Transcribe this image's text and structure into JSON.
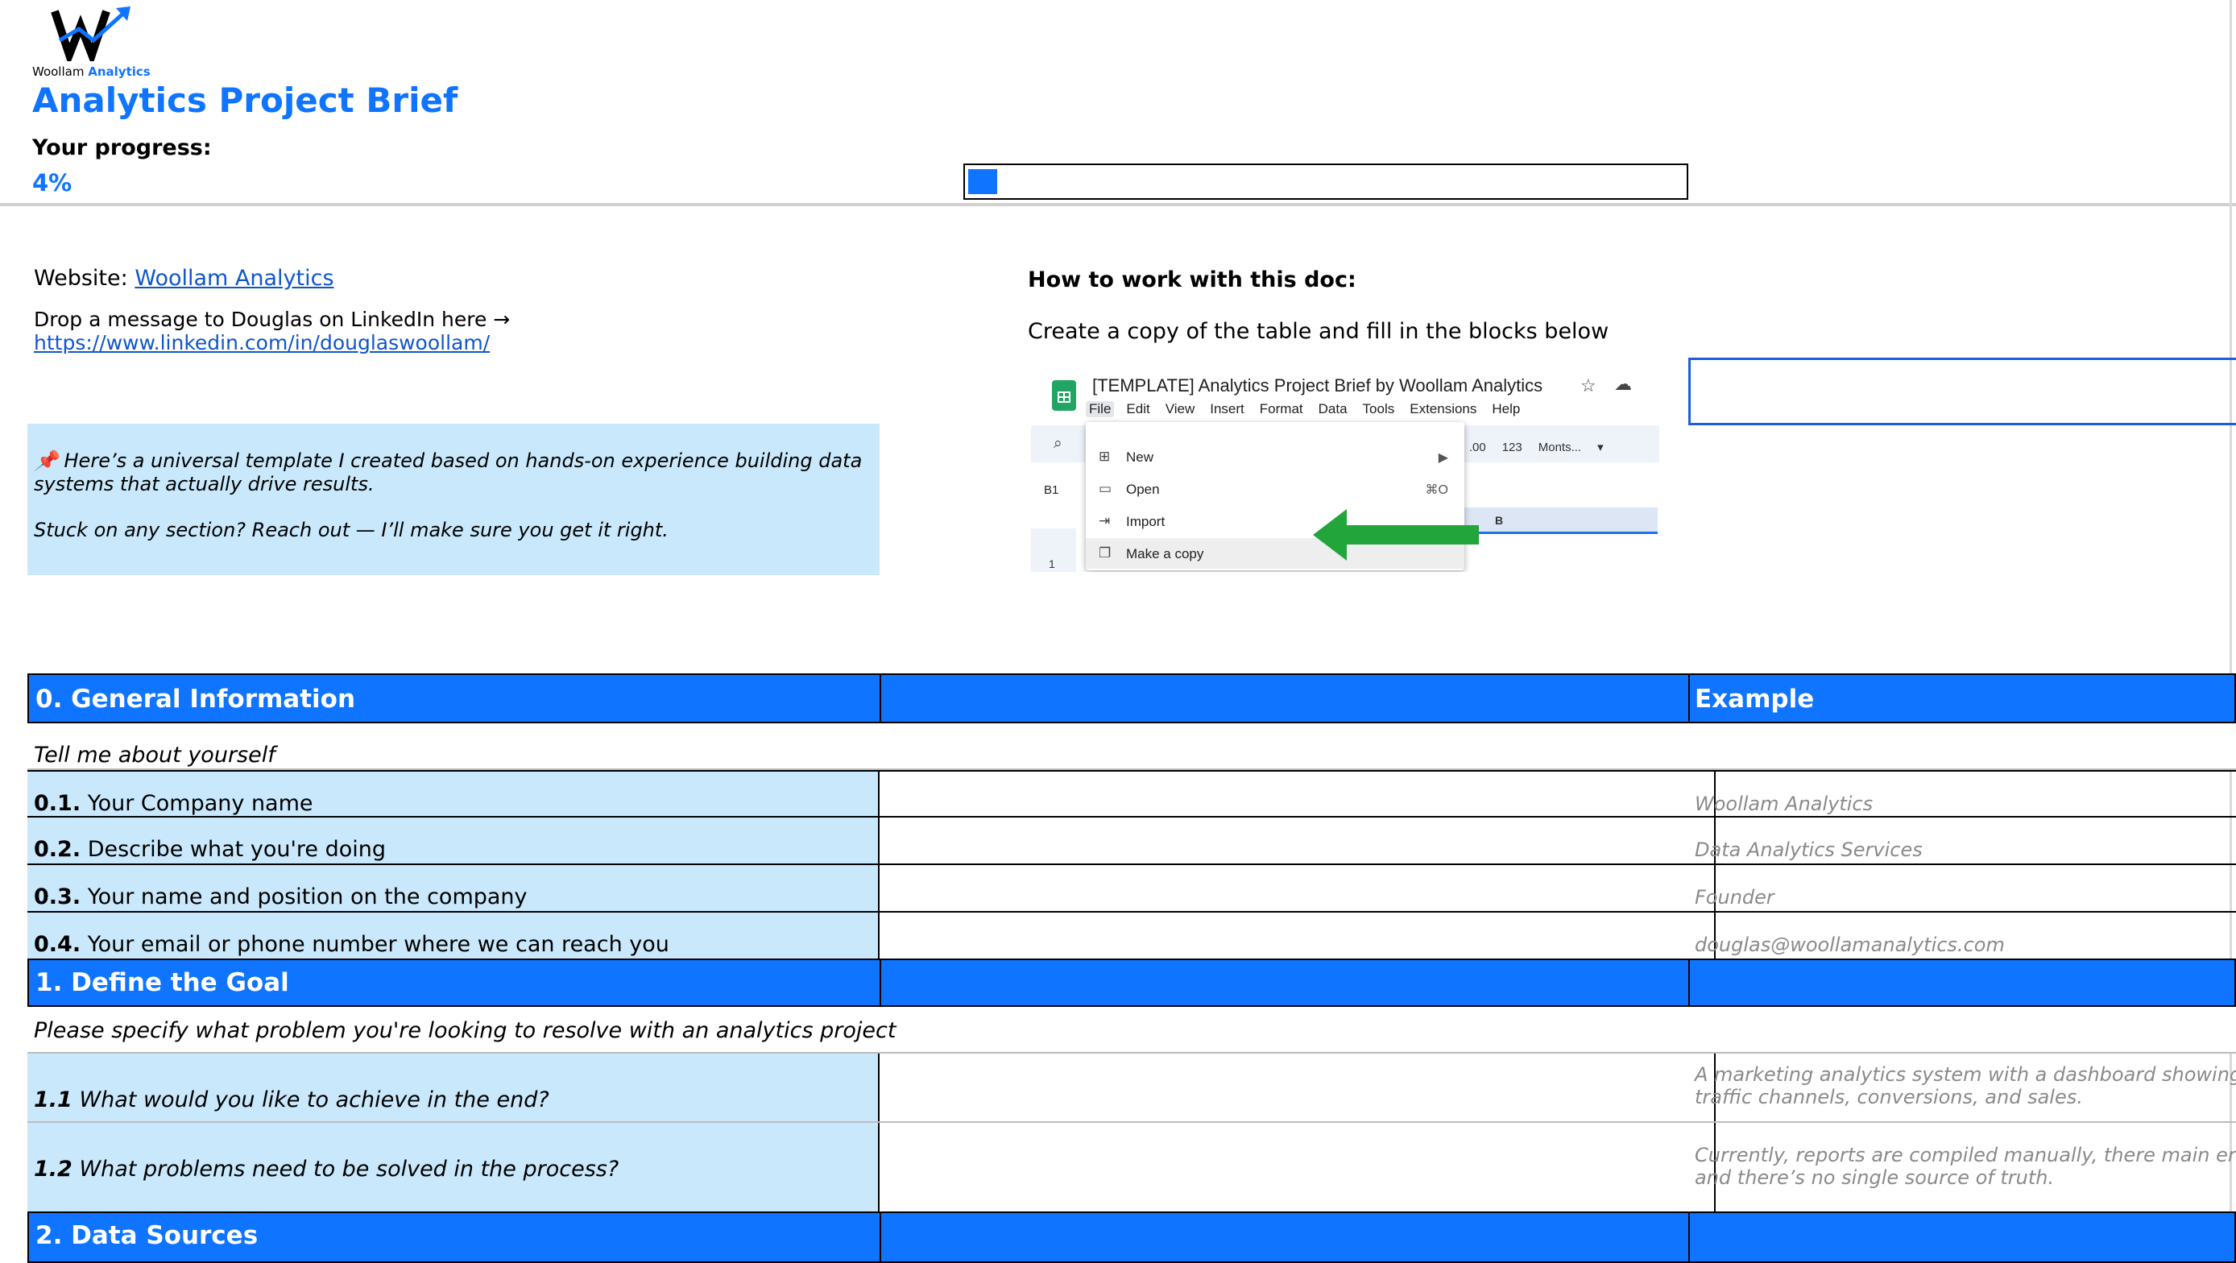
{
  "brand": {
    "logo_name": "Woollam",
    "logo_accent": "Analytics",
    "accent_color": "#0f74ff",
    "label_bg": "#c9e8fb"
  },
  "page": {
    "title": "Analytics Project Brief",
    "progress_label": "Your progress:",
    "progress_value": "4%",
    "progress_fraction": 0.04
  },
  "links": {
    "website_label": "Website:",
    "website_link": "Woollam Analytics",
    "linkedin_text": "Drop a message to Douglas on LinkedIn here →",
    "linkedin_url": "https://www.linkedin.com/in/douglaswoollam/"
  },
  "note": {
    "icon": "pushpin-icon",
    "line1": "📌  Here’s a universal template I created based on hands-on experience building data systems that actually drive results.",
    "line2": "Stuck on any section? Reach out — I’ll make sure you get it right."
  },
  "howto": {
    "title": "How to work with this doc:",
    "description": "Create a copy of the table and fill in the blocks below"
  },
  "screenshot": {
    "doc_title": "[TEMPLATE] Analytics Project Brief by Woollam Analytics",
    "menubar": [
      "File",
      "Edit",
      "View",
      "Insert",
      "Format",
      "Data",
      "Tools",
      "Extensions",
      "Help"
    ],
    "toolbar": [
      "%",
      ".0",
      ".00",
      "123",
      "Monts..."
    ],
    "cell_ref": "B1",
    "column": "B",
    "row": "1",
    "menu": [
      {
        "icon": "plus-box-icon",
        "label": "New",
        "shortcut": "▶"
      },
      {
        "icon": "folder-icon",
        "label": "Open",
        "shortcut": "⌘O"
      },
      {
        "icon": "import-icon",
        "label": "Import",
        "shortcut": ""
      },
      {
        "icon": "copy-icon",
        "label": "Make a copy",
        "shortcut": ""
      }
    ]
  },
  "table": {
    "section0": {
      "title": "0. General Information",
      "example_header": "Example",
      "subtitle": "Tell me about yourself",
      "rows": [
        {
          "num": "0.1.",
          "label": "Your Company name",
          "example": "Woollam Analytics"
        },
        {
          "num": "0.2.",
          "label": "Describe what you're doing",
          "example": "Data Analytics Services"
        },
        {
          "num": "0.3.",
          "label": "Your name and position on the company",
          "example": "Founder"
        },
        {
          "num": "0.4.",
          "label": "Your email or phone number where we can reach you",
          "example": "douglas@woollamanalytics.com"
        }
      ]
    },
    "section1": {
      "title": "1. Define the Goal",
      "subtitle": "Please specify what problem you're looking to resolve with an analytics project",
      "rows": [
        {
          "num": "1.1",
          "label": "What would you like to achieve in the end?",
          "example_line1": "A marketing analytics system with a dashboard showing the",
          "example_line2": "traffic channels, conversions, and sales."
        },
        {
          "num": "1.2",
          "label": "What problems need to be solved in the process?",
          "example_line1": "Currently, reports are compiled manually, there main  errors",
          "example_line2": "and there’s no single source of truth."
        }
      ]
    },
    "section2": {
      "title": "2. Data Sources"
    }
  }
}
